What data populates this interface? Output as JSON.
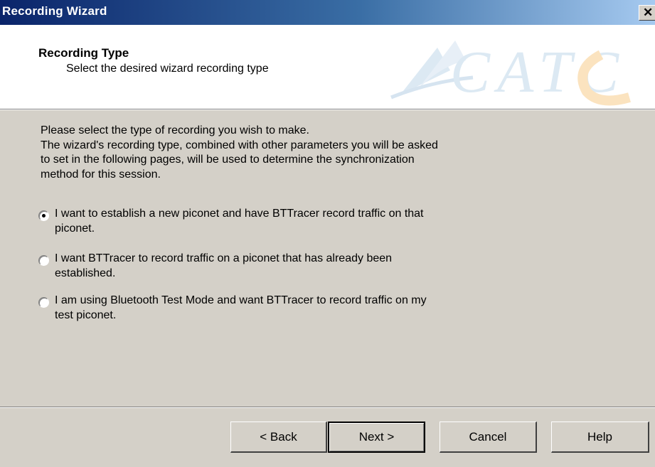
{
  "window": {
    "title": "Recording Wizard",
    "close_glyph": "✕"
  },
  "header": {
    "title": "Recording Type",
    "subtitle": "Select the desired wizard recording type",
    "logo_text": "CATC"
  },
  "intro": {
    "lines": [
      "Please select the type of recording you wish to make.",
      "The wizard's recording type, combined with other parameters you will be asked",
      "to set in the following pages, will be used to determine the synchronization",
      "method for this session."
    ]
  },
  "options": [
    {
      "lines": [
        "I want to establish a new piconet and have BTTracer record traffic on that",
        "piconet."
      ],
      "selected": true
    },
    {
      "lines": [
        "I want BTTracer to record traffic on a piconet that has already been",
        "established."
      ],
      "selected": false
    },
    {
      "lines": [
        "I am using Bluetooth Test Mode and want BTTracer to record traffic on my",
        "test piconet."
      ],
      "selected": false
    }
  ],
  "buttons": {
    "back": "< Back",
    "next": "Next >",
    "cancel": "Cancel",
    "help": "Help"
  },
  "colors": {
    "titlebar_start": "#0a246a",
    "titlebar_end": "#a6caf0",
    "dialog_bg": "#d4d0c8",
    "logo_accent": "#f5a623"
  }
}
